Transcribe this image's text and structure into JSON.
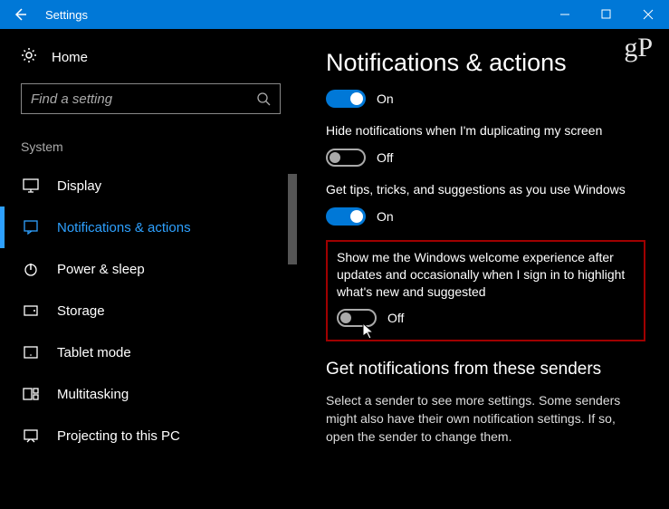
{
  "titlebar": {
    "title": "Settings"
  },
  "sidebar": {
    "home": "Home",
    "search_placeholder": "Find a setting",
    "section": "System",
    "items": [
      {
        "label": "Display"
      },
      {
        "label": "Notifications & actions"
      },
      {
        "label": "Power & sleep"
      },
      {
        "label": "Storage"
      },
      {
        "label": "Tablet mode"
      },
      {
        "label": "Multitasking"
      },
      {
        "label": "Projecting to this PC"
      }
    ]
  },
  "main": {
    "heading": "Notifications & actions",
    "toggle0": {
      "state": "On"
    },
    "toggle1": {
      "label": "Hide notifications when I'm duplicating my screen",
      "state": "Off"
    },
    "toggle2": {
      "label": "Get tips, tricks, and suggestions as you use Windows",
      "state": "On"
    },
    "toggle3": {
      "label": "Show me the Windows welcome experience after updates and occasionally when I sign in to highlight what's new and suggested",
      "state": "Off"
    },
    "senders_heading": "Get notifications from these senders",
    "senders_text": "Select a sender to see more settings. Some senders might also have their own notification settings. If so, open the sender to change them."
  },
  "watermark": "gP"
}
